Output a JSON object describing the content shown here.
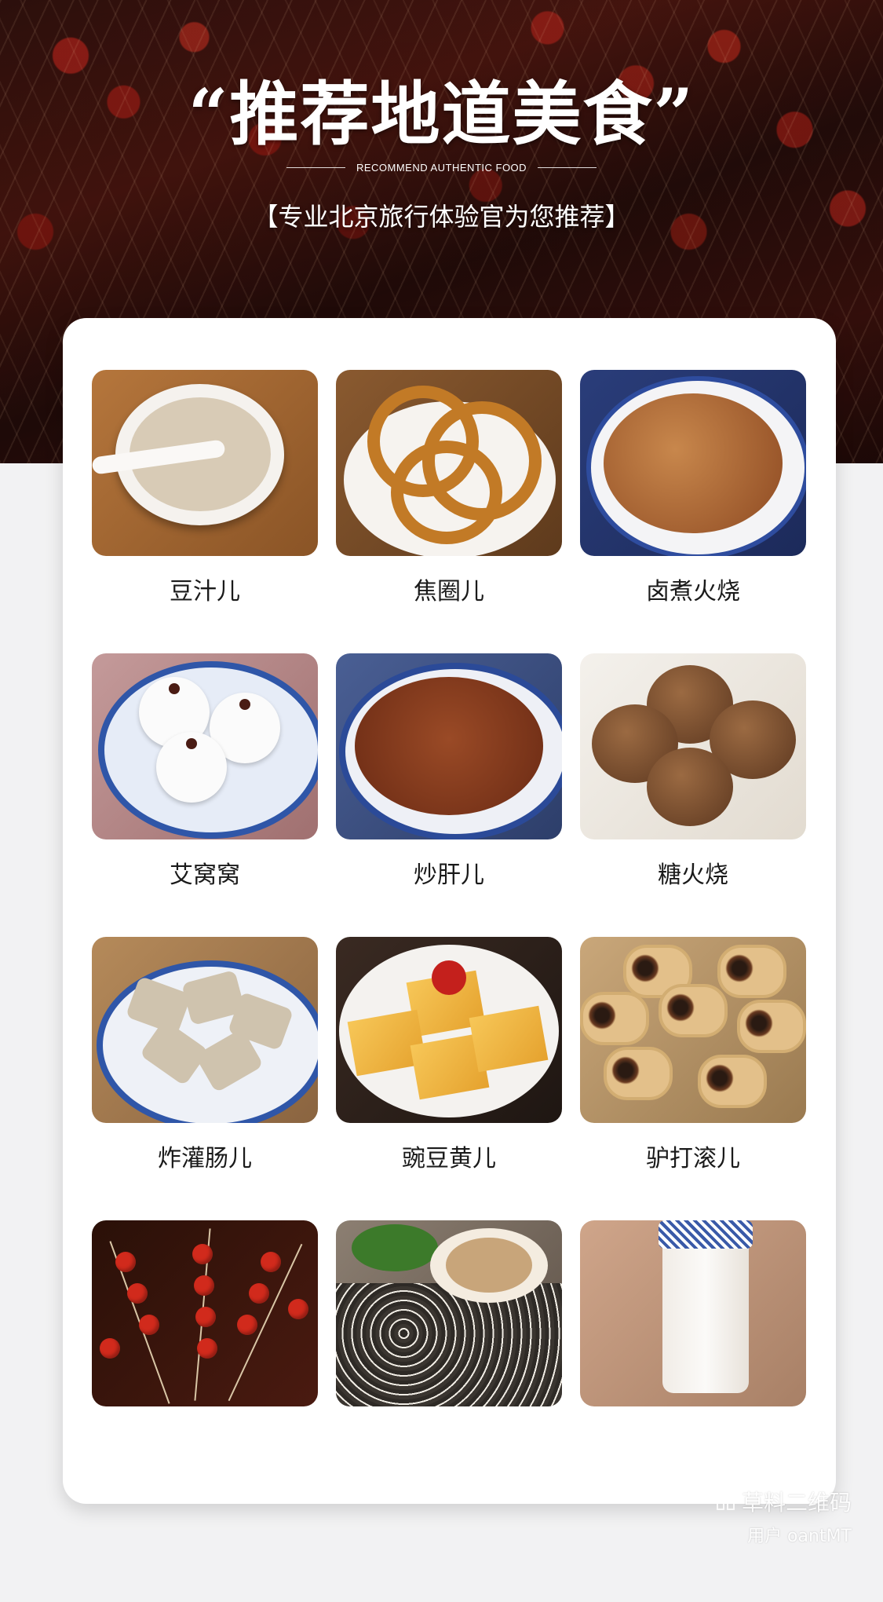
{
  "hero": {
    "title": "“推荐地道美食”",
    "subtitle": "RECOMMEND AUTHENTIC FOOD",
    "tagline": "【专业北京旅行体验官为您推荐】"
  },
  "foods": [
    {
      "name": "豆汁儿"
    },
    {
      "name": "焦圈儿"
    },
    {
      "name": "卤煮火烧"
    },
    {
      "name": "艾窝窝"
    },
    {
      "name": "炒肝儿"
    },
    {
      "name": "糖火烧"
    },
    {
      "name": "炸灌肠儿"
    },
    {
      "name": "豌豆黄儿"
    },
    {
      "name": "驴打滚儿"
    },
    {
      "name": ""
    },
    {
      "name": ""
    },
    {
      "name": ""
    }
  ],
  "watermark": {
    "brand": "草料二维码",
    "user": "用户 oantMT",
    "icon": "qr-code-icon"
  },
  "colors": {
    "background": "#f2f2f3",
    "card": "#ffffff",
    "text": "#1a1a1a",
    "hero_text": "#ffffff"
  }
}
